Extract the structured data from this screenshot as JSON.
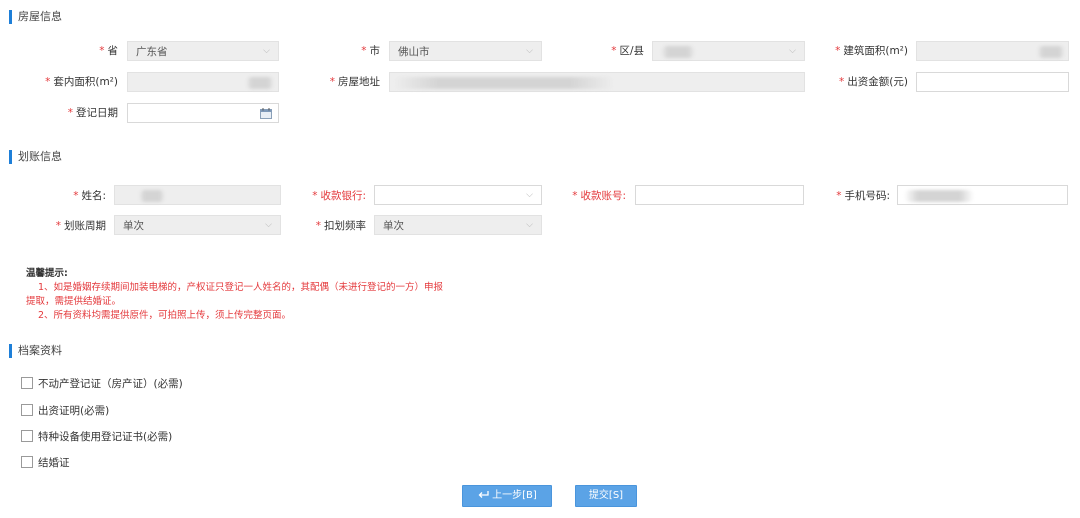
{
  "house_section": {
    "title": "房屋信息",
    "province_label": "省",
    "province_value": "广东省",
    "city_label": "市",
    "city_value": "佛山市",
    "district_label": "区/县",
    "building_area_label": "建筑面积(m²)",
    "inner_area_label": "套内面积(m²)",
    "address_label": "房屋地址",
    "investment_label": "出资金额(元)",
    "reg_date_label": "登记日期"
  },
  "transfer_section": {
    "title": "划账信息",
    "name_label": "姓名:",
    "bank_label": "收款银行:",
    "account_label": "收款账号:",
    "phone_label": "手机号码:",
    "period_label": "划账周期",
    "period_value": "单次",
    "frequency_label": "扣划频率",
    "frequency_value": "单次"
  },
  "tips": {
    "title": "温馨提示:",
    "tip1": "1、如是婚姻存续期间加装电梯的，产权证只登记一人姓名的，其配偶（未进行登记的一方）申报提取，需提供结婚证。",
    "tip2": "2、所有资料均需提供原件，可拍照上传，须上传完整页面。"
  },
  "archive_section": {
    "title": "档案资料",
    "items": [
      "不动产登记证（房产证）(必需)",
      "出资证明(必需)",
      "特种设备使用登记证书(必需)",
      "结婚证"
    ]
  },
  "buttons": {
    "prev": "上一步[B]",
    "submit": "提交[S]"
  },
  "colors": {
    "accent": "#1e7fd8",
    "required": "#e4393c",
    "button": "#5ba3e6"
  }
}
